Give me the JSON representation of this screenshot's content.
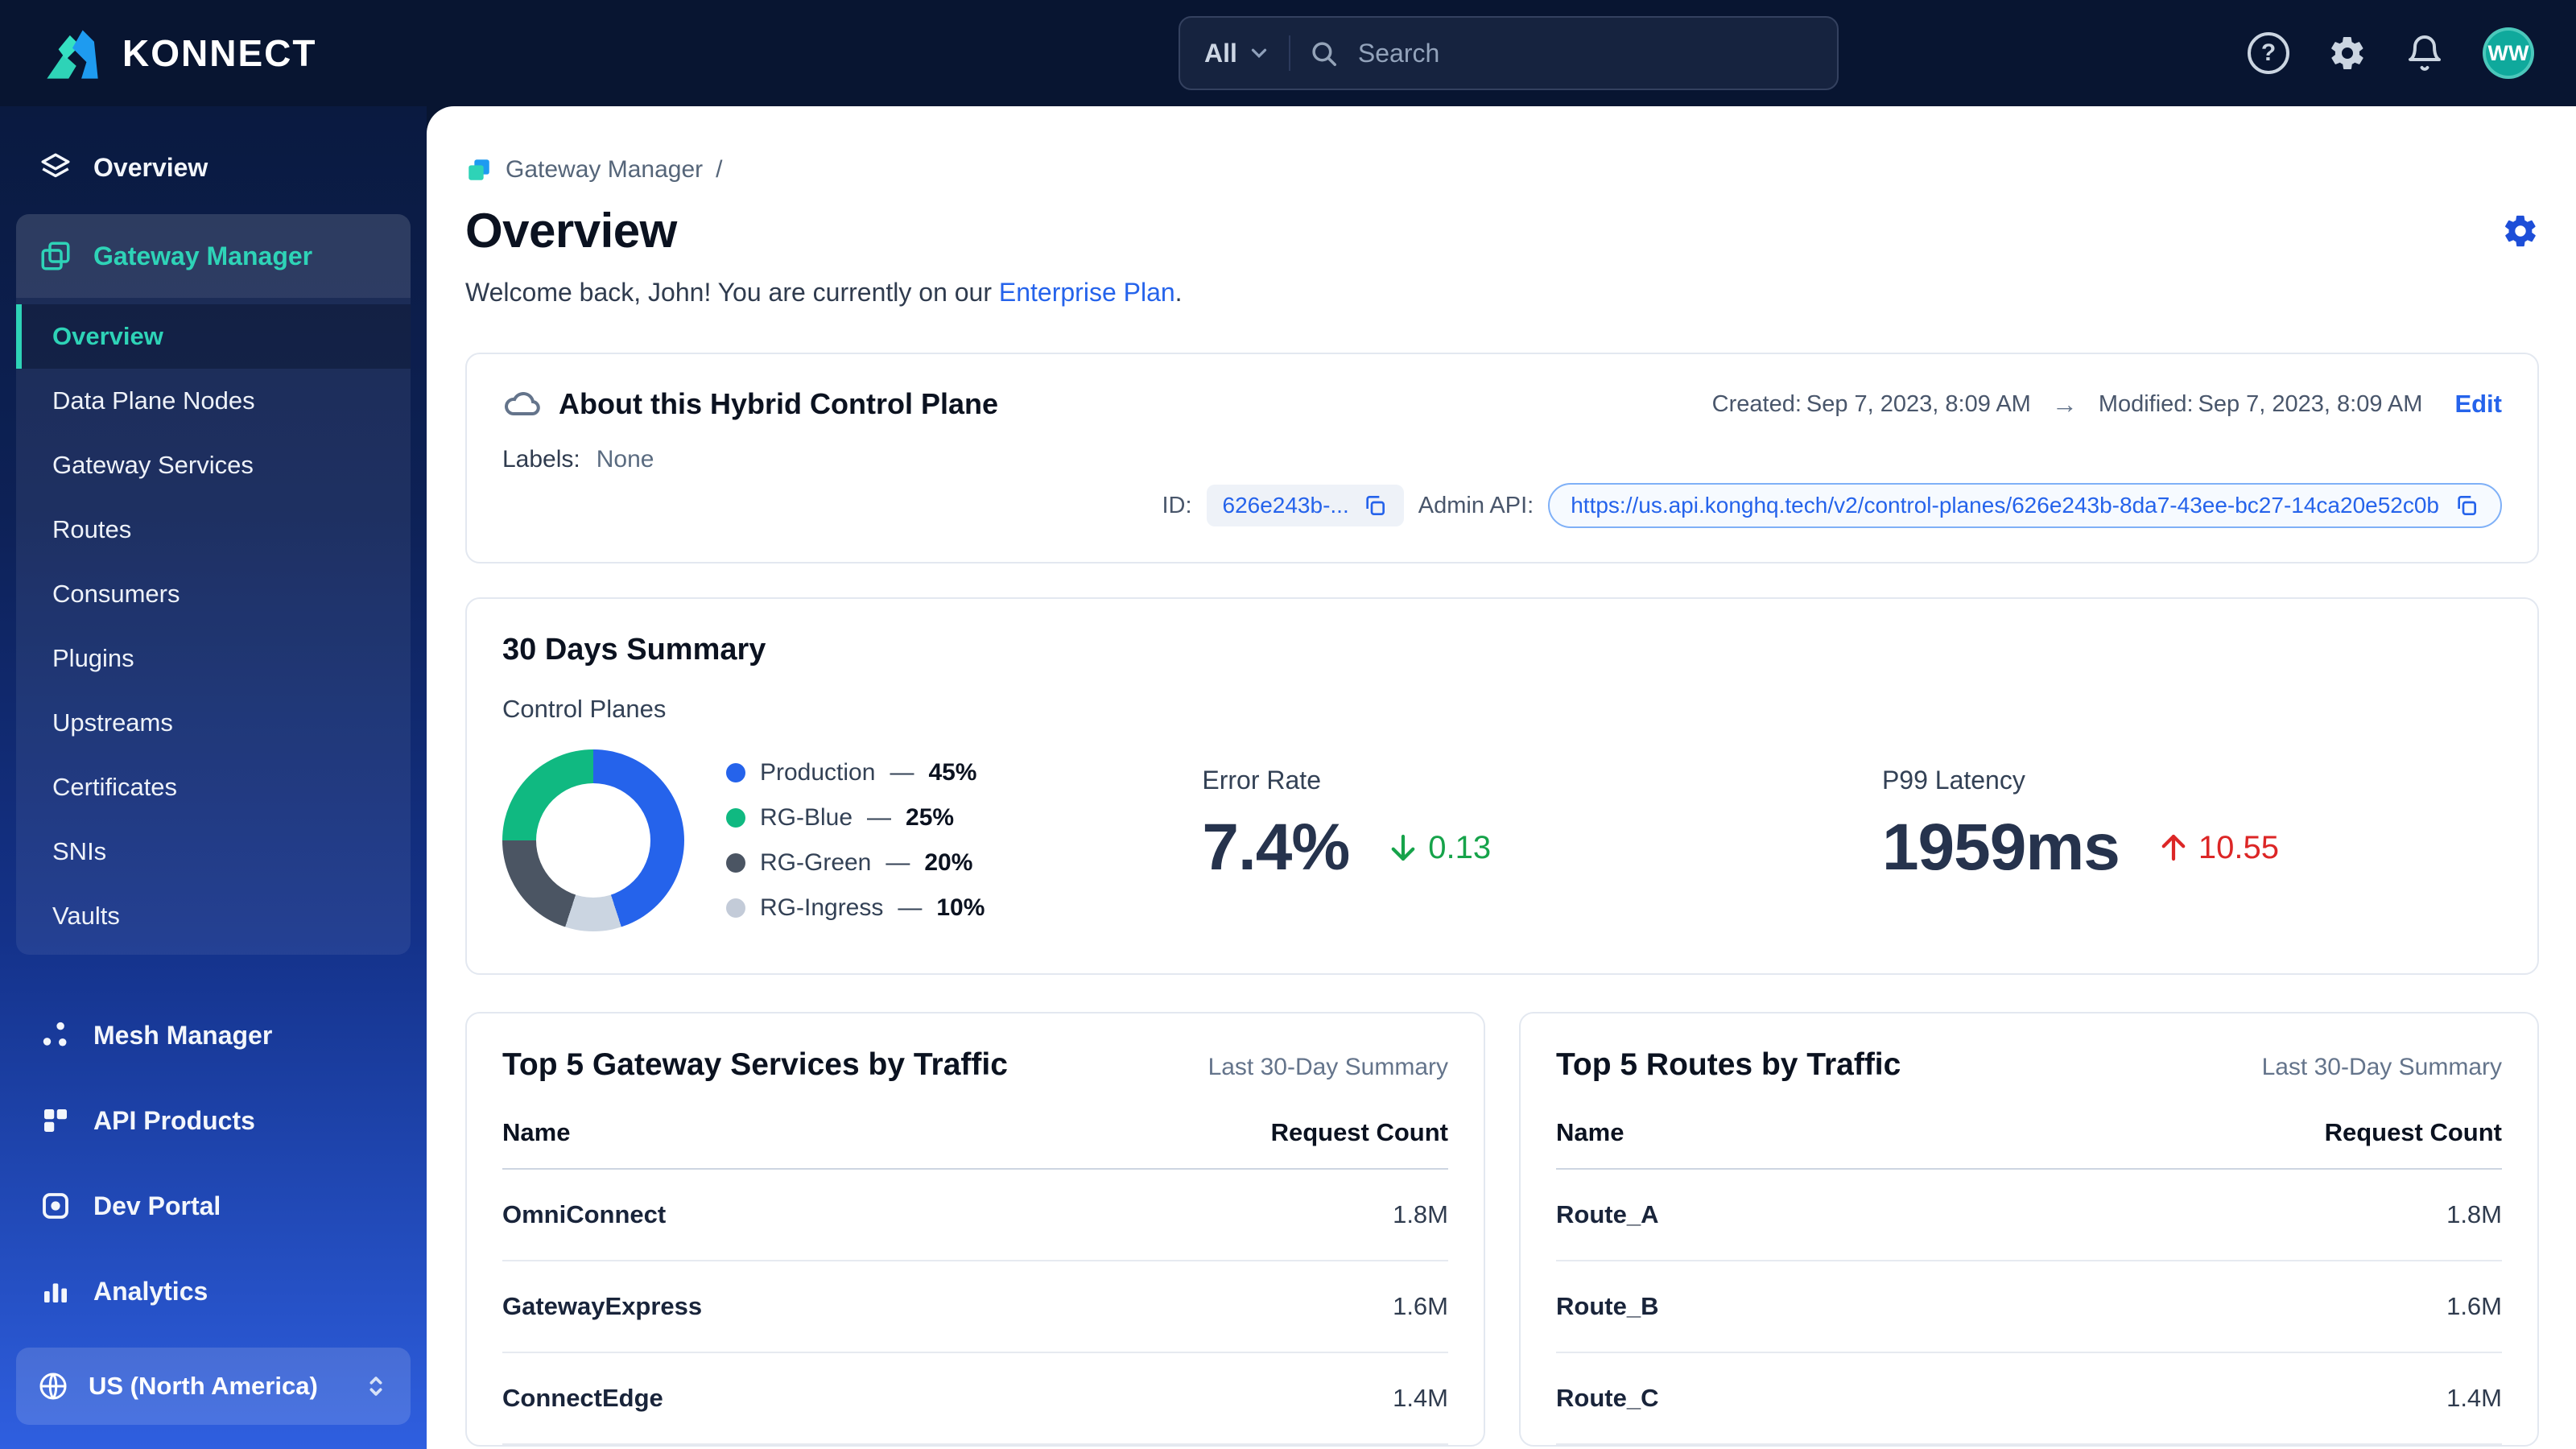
{
  "colors": {
    "accent_teal": "#2ed3b7",
    "link_blue": "#2563eb",
    "positive_green": "#16a34a",
    "negative_red": "#dc2626",
    "topbar_bg": "#081531"
  },
  "topbar": {
    "brand": "KONNECT",
    "filter_label": "All",
    "search_placeholder": "Search",
    "avatar_initials": "WW"
  },
  "sidebar": {
    "overview_label": "Overview",
    "gateway_manager_label": "Gateway Manager",
    "submenu": [
      {
        "label": "Overview"
      },
      {
        "label": "Data Plane Nodes"
      },
      {
        "label": "Gateway Services"
      },
      {
        "label": "Routes"
      },
      {
        "label": "Consumers"
      },
      {
        "label": "Plugins"
      },
      {
        "label": "Upstreams"
      },
      {
        "label": "Certificates"
      },
      {
        "label": "SNIs"
      },
      {
        "label": "Vaults"
      }
    ],
    "items": [
      {
        "label": "Mesh Manager"
      },
      {
        "label": "API Products"
      },
      {
        "label": "Dev Portal"
      },
      {
        "label": "Analytics"
      }
    ],
    "region": "US (North America)"
  },
  "main": {
    "breadcrumb": {
      "label": "Gateway Manager",
      "separator": "/"
    },
    "title": "Overview",
    "welcome": {
      "prefix": "Welcome back, John! You are currently on our ",
      "link": "Enterprise Plan",
      "suffix": "."
    },
    "about": {
      "title": "About this Hybrid Control Plane",
      "created_label": "Created:",
      "created_value": "Sep 7, 2023, 8:09 AM",
      "arrow": "→",
      "modified_label": "Modified:",
      "modified_value": "Sep 7, 2023, 8:09 AM",
      "edit_label": "Edit",
      "labels_label": "Labels:",
      "labels_value": "None",
      "id_label": "ID:",
      "id_value": "626e243b-...",
      "admin_api_label": "Admin API:",
      "admin_api_url": "https://us.api.konghq.tech/v2/control-planes/626e243b-8da7-43ee-bc27-14ca20e52c0b"
    },
    "summary": {
      "title": "30 Days Summary",
      "chart_label": "Control Planes",
      "legend_sep": "—",
      "legend": [
        {
          "name": "Production",
          "pct": "45%"
        },
        {
          "name": "RG-Blue",
          "pct": "25%"
        },
        {
          "name": "RG-Green",
          "pct": "20%"
        },
        {
          "name": "RG-Ingress",
          "pct": "10%"
        }
      ],
      "error_rate": {
        "label": "Error Rate",
        "value": "7.4%",
        "delta": "0.13",
        "direction": "down"
      },
      "p99_latency": {
        "label": "P99 Latency",
        "value": "1959ms",
        "delta": "10.55",
        "direction": "up"
      }
    },
    "services": {
      "title": "Top 5 Gateway Services by Traffic",
      "subtitle": "Last 30-Day Summary",
      "col_name": "Name",
      "col_count": "Request Count",
      "rows": [
        {
          "name": "OmniConnect",
          "count": "1.8M"
        },
        {
          "name": "GatewayExpress",
          "count": "1.6M"
        },
        {
          "name": "ConnectEdge",
          "count": "1.4M"
        }
      ]
    },
    "routes": {
      "title": "Top 5 Routes by Traffic",
      "subtitle": "Last 30-Day Summary",
      "col_name": "Name",
      "col_count": "Request Count",
      "rows": [
        {
          "name": "Route_A",
          "count": "1.8M"
        },
        {
          "name": "Route_B",
          "count": "1.6M"
        },
        {
          "name": "Route_C",
          "count": "1.4M"
        }
      ]
    }
  },
  "chart_data": {
    "type": "pie",
    "title": "Control Planes",
    "labels": [
      "Production",
      "RG-Blue",
      "RG-Green",
      "RG-Ingress"
    ],
    "values": [
      45,
      25,
      20,
      10
    ],
    "unit": "%",
    "colors": [
      "#2563eb",
      "#10b981",
      "#4b5563",
      "#cbd5e1"
    ],
    "legend_position": "right",
    "donut": true
  }
}
